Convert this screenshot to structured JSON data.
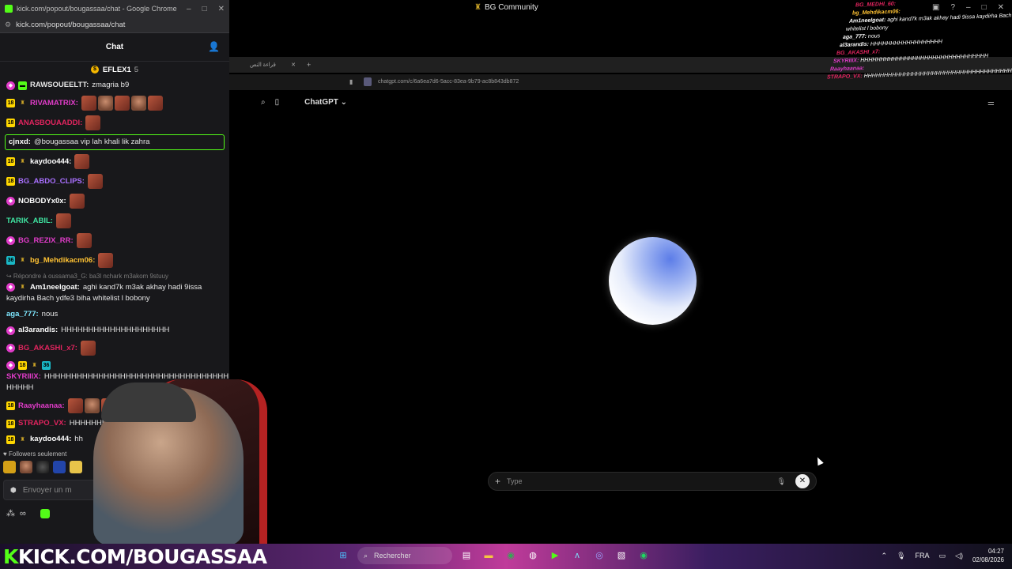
{
  "chat_window": {
    "title": "kick.com/popout/bougassaa/chat - Google Chrome",
    "url": "kick.com/popout/bougassaa/chat",
    "header": "Chat",
    "pinned_user": "EFLEX1",
    "pinned_count": "5",
    "messages": [
      {
        "user": "RAWSOUEELTT",
        "color": "#e6e6e6",
        "text": "zmagria b9",
        "badges": [
          "pink",
          "green"
        ],
        "emotes": 0
      },
      {
        "user": "RIVAMATRIX",
        "color": "#e13cc9",
        "text": "",
        "badges": [
          "sub",
          "og"
        ],
        "emotes": 5
      },
      {
        "user": "ANASBOUAADDI",
        "color": "#e0245e",
        "text": "",
        "badges": [
          "sub"
        ],
        "emotes": 1
      },
      {
        "user": "cjnxd",
        "color": "#ffffff",
        "text": "@bougassaa vip lah khali lik zahra",
        "badges": [],
        "emotes": 0,
        "highlight": true
      },
      {
        "user": "kaydoo444",
        "color": "#ffffff",
        "text": "",
        "badges": [
          "sub",
          "og"
        ],
        "emotes": 1
      },
      {
        "user": "BG_ABDO_CLIPS",
        "color": "#a970ff",
        "text": "",
        "badges": [
          "sub"
        ],
        "emotes": 1
      },
      {
        "user": "NOBODYx0x",
        "color": "#ffffff",
        "text": "",
        "badges": [
          "pink"
        ],
        "emotes": 1
      },
      {
        "user": "TARIK_ABIL",
        "color": "#3fe3a0",
        "text": "",
        "badges": [],
        "emotes": 1
      },
      {
        "user": "BG_REZIX_RR",
        "color": "#e13cc9",
        "text": "",
        "badges": [
          "pink"
        ],
        "emotes": 1
      },
      {
        "user": "bg_Mehdikacm06",
        "color": "#ffc233",
        "text": "",
        "badges": [
          "teal",
          "og"
        ],
        "emotes": 1
      },
      {
        "reply_to": "Répondre à oussama3_G: ba3l nchark m3akom 9stuuy",
        "user": "Am1neelgoat",
        "color": "#ffffff",
        "text": "aghi kand7k m3ak akhay hadi 9issa kaydirha Bach ydfe3 biha whitelist l bobony",
        "badges": [
          "pink",
          "og"
        ],
        "emotes": 0
      },
      {
        "user": "aga_777",
        "color": "#7ee7ff",
        "text": "nous",
        "badges": [],
        "emotes": 0
      },
      {
        "user": "al3arandis",
        "color": "#ffffff",
        "text": "HHHHHHHHHHHHHHHHHHHH",
        "badges": [
          "pink"
        ],
        "emotes": 0
      },
      {
        "user": "BG_AKASHI_x7",
        "color": "#e0245e",
        "text": "",
        "badges": [
          "pink"
        ],
        "emotes": 1
      },
      {
        "user": "SKYRIIIX",
        "color": "#e13cc9",
        "text": "HHHHHHHHHHHHHHHHHHHHHHHHHHHHHHHHHHHHHHHH HHHHH",
        "badges": [
          "pink",
          "sub",
          "og",
          "teal"
        ],
        "emotes": 0
      },
      {
        "user": "Raayhaanaa",
        "color": "#e13cc9",
        "text": "",
        "badges": [
          "sub"
        ],
        "emotes": 4
      },
      {
        "user": "STRAPO_VX",
        "color": "#e0245e",
        "text": "HHHHHHHHHHHHHHHHHH HHHHHH",
        "badges": [
          "sub"
        ],
        "emotes": 0
      },
      {
        "user": "kaydoo444",
        "color": "#ffffff",
        "text": "hh",
        "badges": [
          "sub",
          "og"
        ],
        "emotes": 0
      }
    ],
    "followers_only": "Followers seulement",
    "input_placeholder": "Envoyer un m",
    "infinity": "∞"
  },
  "desktop": {
    "window_title": "BG Community",
    "inner_tab_label": "قراءة النص",
    "inner_url": "chatgpt.com/c/6a6ea7d6-5acc-83ea-9b79-ac8b843db872",
    "gpt_title": "ChatGPT",
    "gpt_input_placeholder": "Type"
  },
  "overlay_chat": [
    {
      "user": "BG_MEDHI_60",
      "text": ""
    },
    {
      "user": "bg_Mehdikacm06",
      "text": ""
    },
    {
      "user": "Am1neelgoat",
      "text": "aghi kand7k m3ak akhay hadi 9issa kaydirha Bach ydfe3 biha"
    },
    {
      "user": "",
      "text": "whitelist l bobony"
    },
    {
      "user": "aga_777",
      "text": "nous"
    },
    {
      "user": "al3arandis",
      "text": "HHHHHHHHHHHHHHHHHH"
    },
    {
      "user": "BG_AKASHI_x7",
      "text": ""
    },
    {
      "user": "SKYRIIIX",
      "text": "HHHHHHHHHHHHHHHHHHHHHHHHHHHHHHHH"
    },
    {
      "user": "Raayhaanaa",
      "text": ""
    },
    {
      "user": "STRAPO_VX",
      "text": "HHHHHHHHHHHHHHHHHHHHHHHHHHHHHHHHHHHHHH"
    }
  ],
  "taskbar": {
    "banner_k": "K",
    "banner_text": "KICK.COM/BOUGASSAA",
    "search_label": "Rechercher",
    "language": "FRA",
    "time": "04:27",
    "date": "02/08/2026"
  },
  "colors": {
    "kick_green": "#53fc18",
    "chat_bg": "#18181b"
  }
}
